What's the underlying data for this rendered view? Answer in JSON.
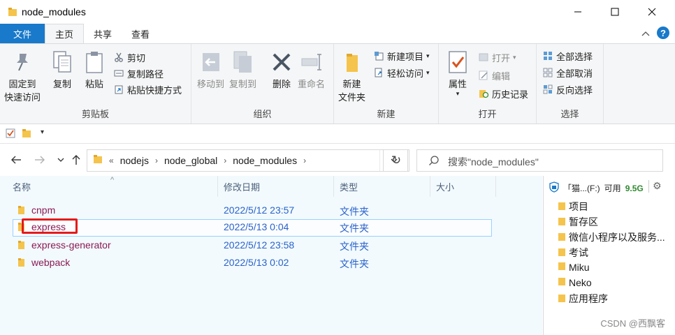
{
  "window": {
    "title": "node_modules"
  },
  "tabs": {
    "file": "文件",
    "home": "主页",
    "share": "共享",
    "view": "查看",
    "help": "?"
  },
  "ribbon": {
    "clipboard": {
      "label": "剪贴板",
      "pin": "固定到\n快速访问",
      "pin_l1": "固定到",
      "pin_l2": "快速访问",
      "copy": "复制",
      "paste": "粘贴",
      "cut": "剪切",
      "copy_path": "复制路径",
      "paste_shortcut": "粘贴快捷方式"
    },
    "organize": {
      "label": "组织",
      "move_to": "移动到",
      "copy_to": "复制到",
      "delete": "删除",
      "rename": "重命名"
    },
    "new": {
      "label": "新建",
      "new_folder_l1": "新建",
      "new_folder_l2": "文件夹",
      "new_item": "新建项目",
      "easy_access": "轻松访问"
    },
    "open": {
      "label": "打开",
      "properties": "属性",
      "open": "打开",
      "edit": "编辑",
      "history": "历史记录"
    },
    "select": {
      "label": "选择",
      "select_all": "全部选择",
      "select_none": "全部取消",
      "invert": "反向选择"
    }
  },
  "address": {
    "crumbs": [
      "nodejs",
      "node_global",
      "node_modules"
    ],
    "overflow": "«"
  },
  "search": {
    "placeholder": "搜索\"node_modules\""
  },
  "columns": {
    "name": "名称",
    "date": "修改日期",
    "type": "类型",
    "size": "大小"
  },
  "files": [
    {
      "name": "cnpm",
      "date": "2022/5/12 23:57",
      "type": "文件夹"
    },
    {
      "name": "express",
      "date": "2022/5/13 0:04",
      "type": "文件夹"
    },
    {
      "name": "express-generator",
      "date": "2022/5/12 23:58",
      "type": "文件夹"
    },
    {
      "name": "webpack",
      "date": "2022/5/13 0:02",
      "type": "文件夹"
    }
  ],
  "side_panel": {
    "drive_label": "「猫...(F:)",
    "free_prefix": "可用",
    "free_value": "9.5G",
    "items": [
      "项目",
      "暂存区",
      "微信小程序以及服务...",
      "考试",
      "Miku",
      "Neko",
      "应用程序"
    ]
  },
  "watermark": "CSDN @西飘客",
  "colors": {
    "accent": "#1979ca",
    "folder": "#f5c44d",
    "file_name": "#8b1a53",
    "meta_text": "#2a62c9",
    "highlight_box": "#e41a1a"
  }
}
